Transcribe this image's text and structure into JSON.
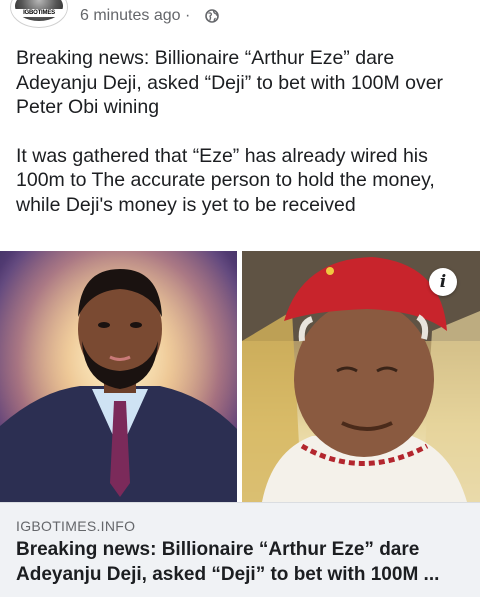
{
  "post": {
    "source_avatar_text": "IGBOTIMES",
    "time_label": "6 minutes ago",
    "separator": "·",
    "privacy_icon": "globe-icon",
    "paragraphs": [
      "Breaking news: Billionaire “Arthur Eze” dare Adeyanju Deji, asked “Deji” to bet with 100M over Peter Obi wining",
      "It was gathered that “Eze” has already wired his 100m to The accurate person to hold the money, while Deji's money is yet to be received"
    ]
  },
  "images": {
    "left": "photo-man-suit",
    "right": "photo-elder-red-cap",
    "overlay_icon": "info-icon",
    "overlay_glyph": "i"
  },
  "link_preview": {
    "domain": "IGBOTIMES.INFO",
    "title": "Breaking news: Billionaire “Arthur Eze” dare Adeyanju Deji, asked “Deji” to bet with 100M ..."
  },
  "colors": {
    "text_primary": "#1c1e21",
    "text_secondary": "#65676b",
    "preview_bg": "#f0f2f5"
  }
}
